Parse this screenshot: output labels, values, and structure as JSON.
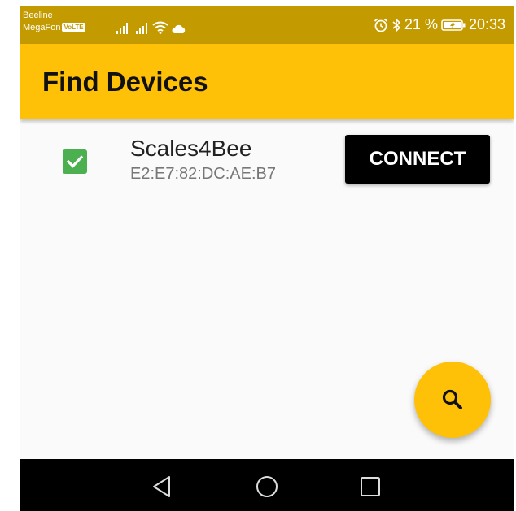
{
  "status_bar": {
    "carrier_1": "Beeline",
    "carrier_2": "MegaFon",
    "volte_badge": "VoLTE",
    "battery_percent": "21 %",
    "time": "20:33",
    "icons": [
      "signal-icon",
      "signal-icon",
      "wifi-icon",
      "cloud-icon",
      "alarm-icon",
      "bluetooth-icon",
      "battery-icon"
    ]
  },
  "app_bar": {
    "title": "Find Devices"
  },
  "devices": [
    {
      "name": "Scales4Bee",
      "address": "E2:E7:82:DC:AE:B7",
      "checked": true,
      "button_label": "CONNECT"
    }
  ],
  "fab": {
    "icon": "search-icon"
  },
  "nav_bar": {
    "icons": [
      "back-icon",
      "home-icon",
      "recents-icon"
    ]
  },
  "colors": {
    "status_bar": "#c39a00",
    "app_bar": "#ffc107",
    "checkbox": "#4caf50",
    "connect_button": "#000000",
    "fab": "#ffc107",
    "nav_bar": "#000000"
  }
}
